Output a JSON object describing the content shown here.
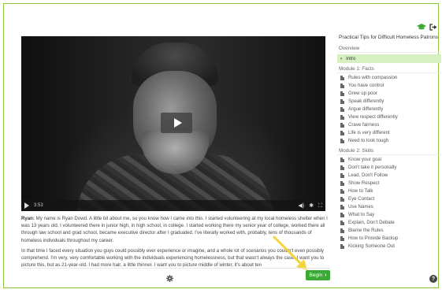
{
  "colors": {
    "accent": "#3aaa35",
    "border": "#8cc63f",
    "active_bg": "#d7f0c2"
  },
  "top_icons": {
    "cap": "graduation-cap-icon",
    "exit": "sign-out-icon"
  },
  "video": {
    "current_time": "3:53"
  },
  "transcript": {
    "speaker": "Ryan:",
    "paragraph1": "My name is Ryan Dowd. A little bit about me, so you know how I came into this. I started volunteering at my local homeless shelter when I was 13 years old. I volunteered there in junior high, in high school, in college. I started working there my senior year of college, worked there all through law school and grad school, became executive director after I graduated. I've literally worked with, probably, tens of thousands of homeless individuals throughout my career.",
    "paragraph2": "In that time I faced every situation you guys could possibly ever experience or imagine, and a whole lot of scenarios you couldn't even possibly comprehend. I'm very, very comfortable working with the individuals experiencing homelessness, but that wasn't always the case. I want you to picture this, but as 21-year-old. I had more hair, a little thinner. I want you to picture middle of winter, it's about ten"
  },
  "footer": {
    "begin_label": "Begin"
  },
  "sidebar": {
    "title": "Practical Tips for Difficult Homeless Patrons",
    "overview": {
      "label": "Overview",
      "items": [
        "Intro"
      ]
    },
    "module1": {
      "label": "Module 1: Facts",
      "items": [
        "Rules with compassion",
        "You have control",
        "Grew up poor",
        "Speak differently",
        "Argue differently",
        "View respect differently",
        "Crave fairness",
        "Life is very different",
        "Need to look tough"
      ]
    },
    "module2": {
      "label": "Module 2: Skills",
      "items": [
        "Know your goal",
        "Don't take it personally",
        "Lead, Don't Follow",
        "Show Respect",
        "How to Talk",
        "Eye Contact",
        "Use Names",
        "What to Say",
        "Explain, Don't Debate",
        "Blame the Rules",
        "How to Provide Backup",
        "Kicking Someone Out"
      ]
    }
  }
}
